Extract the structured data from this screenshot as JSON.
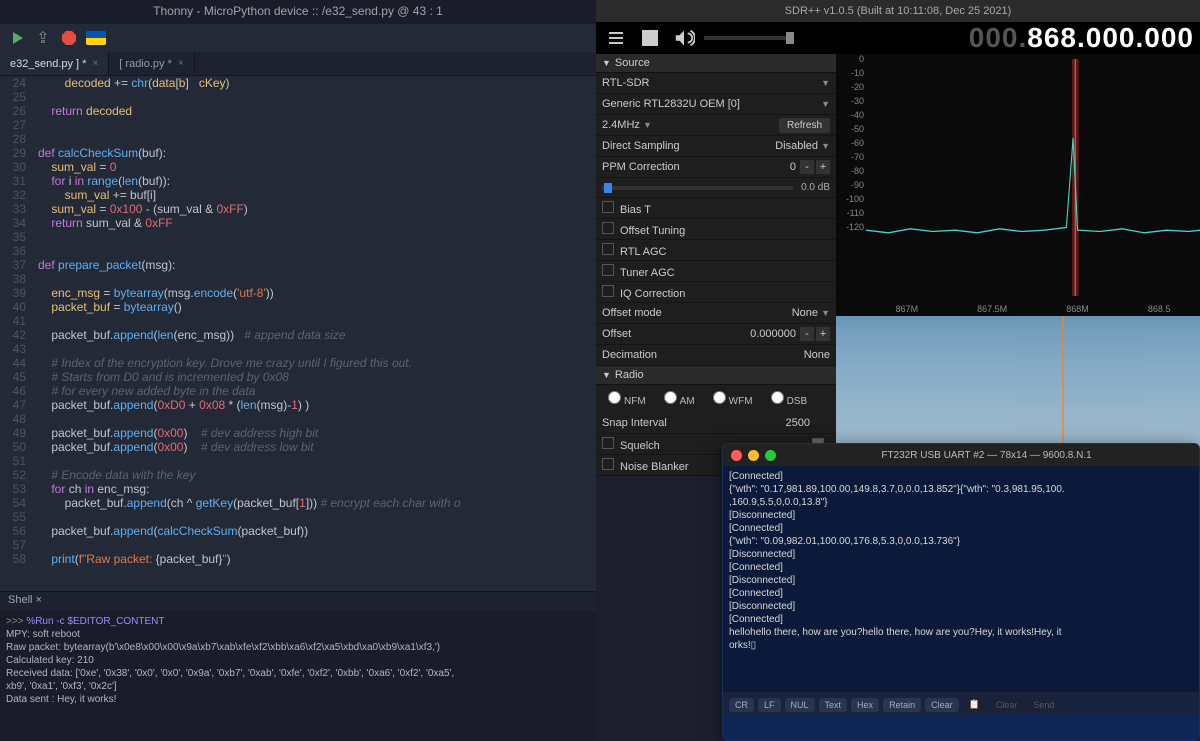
{
  "thonny": {
    "title": "Thonny  -  MicroPython device :: /e32_send.py  @  43 : 1",
    "tabs": [
      {
        "label": "e32_send.py ] *",
        "active": true
      },
      {
        "label": "[ radio.py *",
        "active": false
      }
    ],
    "code_lines": [
      {
        "n": 24,
        "h": "        <span class='id'>decoded</span> += <span class='fn'>chr</span>(<span class='id'>data</span>[<span class='id'>b</span>]   <span class='id'>cKey</span>)"
      },
      {
        "n": 25,
        "h": ""
      },
      {
        "n": 26,
        "h": "    <span class='kw'>return</span> <span class='id'>decoded</span>"
      },
      {
        "n": 27,
        "h": ""
      },
      {
        "n": 28,
        "h": ""
      },
      {
        "n": 29,
        "h": "<span class='kw'>def</span> <span class='fn'>calcCheckSum</span>(buf):"
      },
      {
        "n": 30,
        "h": "    <span class='id'>sum_val</span> = <span class='num'>0</span>"
      },
      {
        "n": 31,
        "h": "    <span class='kw'>for</span> i <span class='kw'>in</span> <span class='fn'>range</span>(<span class='fn'>len</span>(buf)):"
      },
      {
        "n": 32,
        "h": "        <span class='id'>sum_val</span> += buf[i]"
      },
      {
        "n": 33,
        "h": "    <span class='id'>sum_val</span> = <span class='num'>0x100</span> - (sum_val &amp; <span class='num'>0xFF</span>)"
      },
      {
        "n": 34,
        "h": "    <span class='kw'>return</span> sum_val &amp; <span class='num'>0xFF</span>"
      },
      {
        "n": 35,
        "h": ""
      },
      {
        "n": 36,
        "h": ""
      },
      {
        "n": 37,
        "h": "<span class='kw'>def</span> <span class='fn'>prepare_packet</span>(msg):"
      },
      {
        "n": 38,
        "h": ""
      },
      {
        "n": 39,
        "h": "    <span class='id'>enc_msg</span> = <span class='fn'>bytearray</span>(msg.<span class='fn'>encode</span>(<span class='str'>'utf-8'</span>))"
      },
      {
        "n": 40,
        "h": "    <span class='id'>packet_buf</span> = <span class='fn'>bytearray</span>()"
      },
      {
        "n": 41,
        "h": ""
      },
      {
        "n": 42,
        "h": "    packet_buf.<span class='fn'>append</span>(<span class='fn'>len</span>(enc_msg))   <span class='cm'># append data size</span>"
      },
      {
        "n": 43,
        "h": ""
      },
      {
        "n": 44,
        "h": "    <span class='cm'># Index of the encryption key. Drove me crazy until I figured this out.</span>"
      },
      {
        "n": 45,
        "h": "    <span class='cm'># Starts from D0 and is incremented by 0x08</span>"
      },
      {
        "n": 46,
        "h": "    <span class='cm'># for every new added byte in the data</span>"
      },
      {
        "n": 47,
        "h": "    packet_buf.<span class='fn'>append</span>(<span class='num'>0xD0</span> + <span class='num'>0x08</span> * (<span class='fn'>len</span>(msg)-<span class='num'>1</span>) )"
      },
      {
        "n": 48,
        "h": ""
      },
      {
        "n": 49,
        "h": "    packet_buf.<span class='fn'>append</span>(<span class='num'>0x00</span>)    <span class='cm'># dev address high bit</span>"
      },
      {
        "n": 50,
        "h": "    packet_buf.<span class='fn'>append</span>(<span class='num'>0x00</span>)    <span class='cm'># dev address low bit</span>"
      },
      {
        "n": 51,
        "h": ""
      },
      {
        "n": 52,
        "h": "    <span class='cm'># Encode data with the key</span>"
      },
      {
        "n": 53,
        "h": "    <span class='kw'>for</span> ch <span class='kw'>in</span> enc_msg:"
      },
      {
        "n": 54,
        "h": "        packet_buf.<span class='fn'>append</span>(ch ^ <span class='fn'>getKey</span>(packet_buf[<span class='num'>1</span>])) <span class='cm'># encrypt each char with o</span>"
      },
      {
        "n": 55,
        "h": ""
      },
      {
        "n": 56,
        "h": "    packet_buf.<span class='fn'>append</span>(<span class='fn'>calcCheckSum</span>(packet_buf))"
      },
      {
        "n": 57,
        "h": ""
      },
      {
        "n": 58,
        "h": "    <span class='fn'>print</span>(<span class='str'>f\"Raw packet: </span>{packet_buf}<span class='str'>\"</span>)"
      }
    ],
    "shell_tab": "Shell ×",
    "shell": [
      ">>> %Run -c $EDITOR_CONTENT",
      "",
      "MPY: soft reboot",
      "Raw packet: bytearray(b'\\x0e8\\x00\\x00\\x9a\\xb7\\xab\\xfe\\xf2\\xbb\\xa6\\xf2\\xa5\\xbd\\xa0\\xb9\\xa1\\xf3,')",
      "Calculated key: 210",
      "Received data: ['0xe', '0x38', '0x0', '0x0', '0x9a', '0xb7', '0xab', '0xfe', '0xf2', '0xbb', '0xa6', '0xf2', '0xa5',",
      "xb9', '0xa1', '0xf3', '0x2c']",
      "Data sent : Hey, it works!"
    ]
  },
  "sdr": {
    "title": "SDR++ v1.0.5 (Built at 10:11:08, Dec 25 2021)",
    "frequency_dim": "000.",
    "frequency": "868.000.000",
    "panel": {
      "source_label": "Source",
      "driver": "RTL-SDR",
      "device": "Generic RTL2832U OEM [0]",
      "samplerate": "2.4MHz",
      "refresh": "Refresh",
      "direct_sampling_label": "Direct Sampling",
      "direct_sampling": "Disabled",
      "ppm_label": "PPM Correction",
      "ppm": "0",
      "gain": "0.0 dB",
      "bias_t": "Bias T",
      "offset_tuning": "Offset Tuning",
      "rtl_agc": "RTL AGC",
      "tuner_agc": "Tuner AGC",
      "iq_corr": "IQ Correction",
      "offset_mode_label": "Offset mode",
      "offset_mode": "None",
      "offset_label": "Offset",
      "offset": "0.000000",
      "decimation_label": "Decimation",
      "decimation": "None",
      "radio_label": "Radio",
      "modes": [
        "NFM",
        "AM",
        "WFM",
        "DSB"
      ],
      "snap_label": "Snap Interval",
      "snap": "2500",
      "squelch": "Squelch",
      "noise_blanker": "Noise Blanker"
    },
    "spectrum": {
      "y_ticks": [
        "0",
        "-10",
        "-20",
        "-30",
        "-40",
        "-50",
        "-60",
        "-70",
        "-80",
        "-90",
        "-100",
        "-110",
        "-120"
      ],
      "x_ticks": [
        "867M",
        "867.5M",
        "868M",
        "868.5"
      ]
    }
  },
  "terminal": {
    "title": "FT232R USB UART #2 — 78x14 — 9600.8.N.1",
    "lines": [
      "[Connected]",
      "{\"wth\": \"0.17,981.89,100.00,149.8,3.7,0,0.0,13.852\"}{\"wth\": \"0.3,981.95,100.",
      ",160.9,5.5,0,0.0,13.8\"}",
      "[Disconnected]",
      "[Connected]",
      "{\"wth\": \"0.09,982.01,100.00,176.8,5.3,0,0.0,13.736\"}",
      "[Disconnected]",
      "[Connected]",
      "[Disconnected]",
      "[Connected]",
      "[Disconnected]",
      "[Connected]",
      "hellohello there, how are you?hello there, how are you?Hey, it works!Hey, it",
      "orks!▯"
    ],
    "footer": [
      "CR",
      "LF",
      "NUL",
      "Text",
      "Hex",
      "Retain",
      "Clear",
      "📋",
      "Clear",
      "Send"
    ]
  }
}
